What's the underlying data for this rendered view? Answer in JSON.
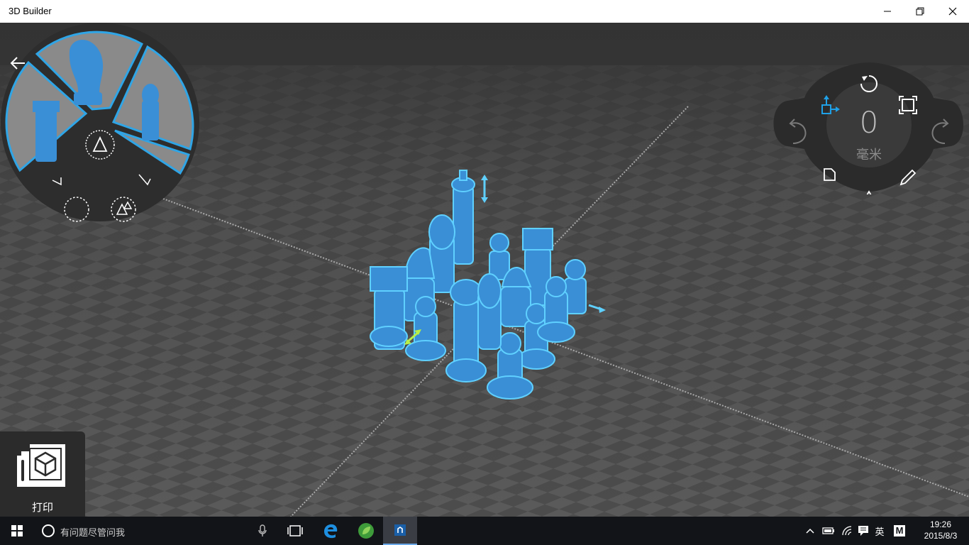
{
  "window": {
    "title": "3D Builder"
  },
  "controller": {
    "value": "0",
    "unit": "毫米"
  },
  "print": {
    "label": "打印"
  },
  "taskbar": {
    "search_placeholder": "有问题尽管问我",
    "ime": "英",
    "ime_mode": "M",
    "time": "19:26",
    "date": "2015/8/3"
  },
  "icons": {
    "back": "arrow-left-icon",
    "rotate": "rotate-icon",
    "scale": "scale-icon",
    "move": "move-icon",
    "undo": "undo-icon",
    "redo": "redo-icon",
    "file": "file-icon",
    "edit": "pencil-icon",
    "triangle": "triangle-icon"
  },
  "colors": {
    "accent": "#1fa0e6",
    "piece": "#3a8fd6",
    "panel": "#2b2b2b",
    "taskbar": "#121418"
  }
}
